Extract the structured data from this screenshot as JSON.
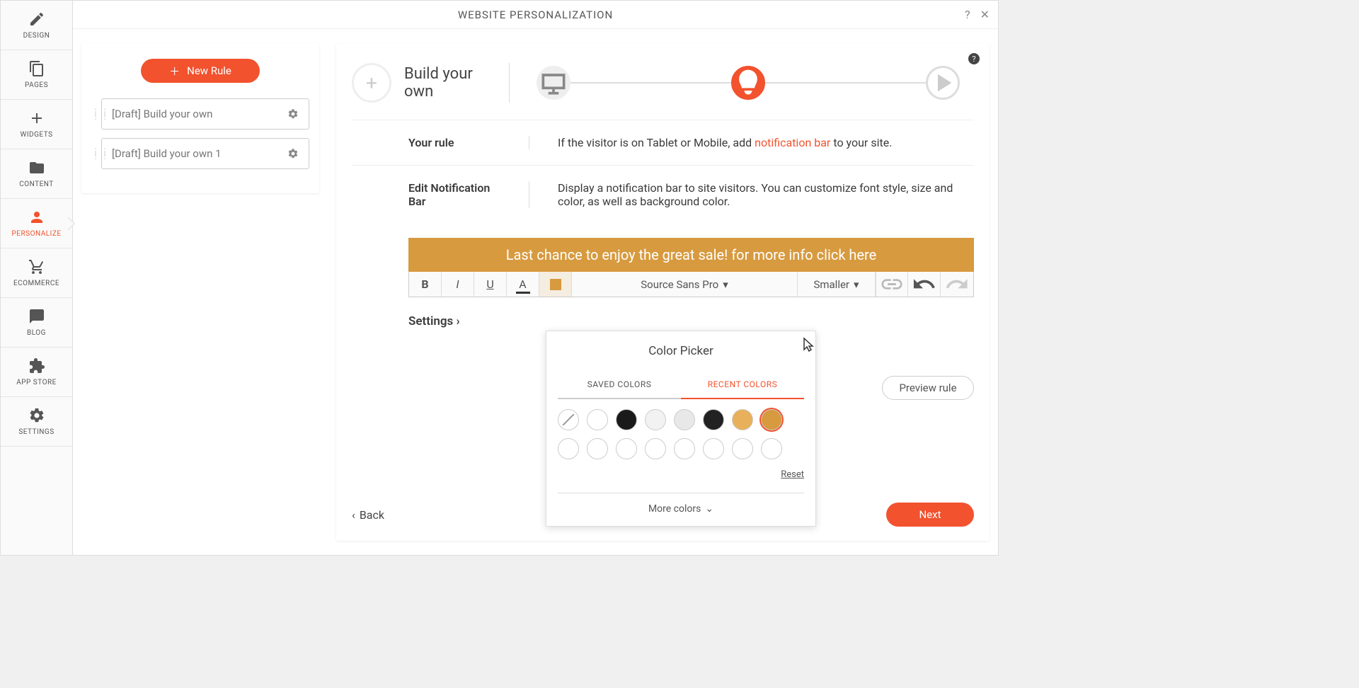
{
  "header": {
    "title": "WEBSITE PERSONALIZATION"
  },
  "nav": {
    "design": "DESIGN",
    "pages": "PAGES",
    "widgets": "WIDGETS",
    "content": "CONTENT",
    "personalize": "PERSONALIZE",
    "ecommerce": "ECOMMERCE",
    "blog": "BLOG",
    "appstore": "APP STORE",
    "settings": "SETTINGS"
  },
  "rules": {
    "new_button": "New Rule",
    "items": [
      {
        "label": "[Draft] Build your own"
      },
      {
        "label": "[Draft] Build your own 1"
      }
    ]
  },
  "main": {
    "step_title": "Build your own",
    "your_rule_label": "Your rule",
    "your_rule_prefix": "If the visitor is on Tablet or Mobile, add ",
    "your_rule_link": "notification bar",
    "your_rule_suffix": " to your site.",
    "edit_label": "Edit Notification Bar",
    "edit_desc": "Display a notification bar to site visitors. You can customize font style, size and color, as well as background color.",
    "notif_text": "Last chance to enjoy the great sale! for more info click here",
    "toolbar": {
      "font": "Source Sans Pro",
      "size": "Smaller"
    },
    "settings_label": "Settings",
    "preview": "Preview rule",
    "back": "Back",
    "next": "Next"
  },
  "color_picker": {
    "title": "Color Picker",
    "tab_saved": "SAVED COLORS",
    "tab_recent": "RECENT COLORS",
    "reset": "Reset",
    "more": "More colors",
    "swatches": [
      {
        "color": "none",
        "selected": false
      },
      {
        "color": "#ffffff",
        "selected": false
      },
      {
        "color": "#1a1a1a",
        "selected": false
      },
      {
        "color": "#f2f2f2",
        "selected": false
      },
      {
        "color": "#e8e8e8",
        "selected": false
      },
      {
        "color": "#222222",
        "selected": false
      },
      {
        "color": "#e8b05a",
        "selected": false
      },
      {
        "color": "#d79a3f",
        "selected": true
      },
      {
        "color": "#ffffff",
        "selected": false
      },
      {
        "color": "#ffffff",
        "selected": false
      },
      {
        "color": "#ffffff",
        "selected": false
      },
      {
        "color": "#ffffff",
        "selected": false
      },
      {
        "color": "#ffffff",
        "selected": false
      },
      {
        "color": "#ffffff",
        "selected": false
      },
      {
        "color": "#ffffff",
        "selected": false
      },
      {
        "color": "#ffffff",
        "selected": false
      }
    ]
  }
}
